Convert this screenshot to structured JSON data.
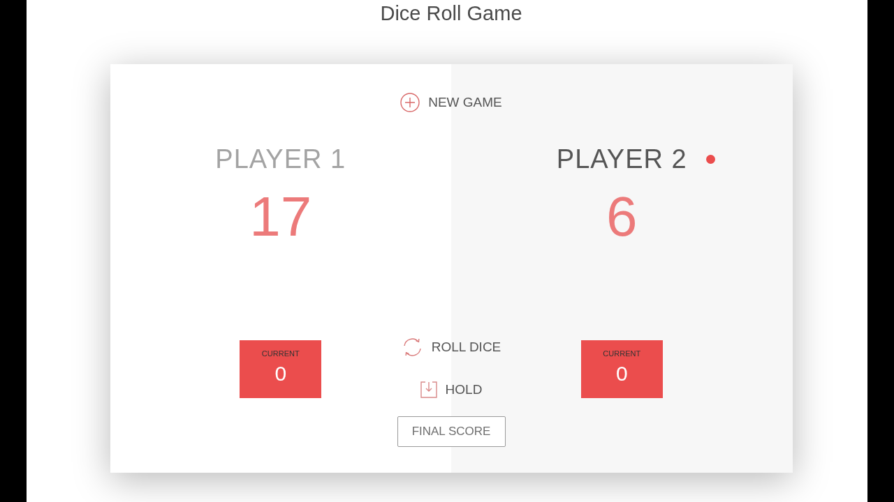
{
  "title": "Dice Roll Game",
  "new_game": {
    "label": "NEW GAME"
  },
  "players": [
    {
      "name": "PLAYER 1",
      "score": "17",
      "current_label": "CURRENT",
      "current": "0",
      "active": false
    },
    {
      "name": "PLAYER 2",
      "score": "6",
      "current_label": "CURRENT",
      "current": "0",
      "active": true
    }
  ],
  "actions": [
    {
      "kind": "roll",
      "label": "ROLL DICE"
    },
    {
      "kind": "hold",
      "label": "HOLD"
    }
  ],
  "final_score": {
    "placeholder": "FINAL SCORE"
  }
}
